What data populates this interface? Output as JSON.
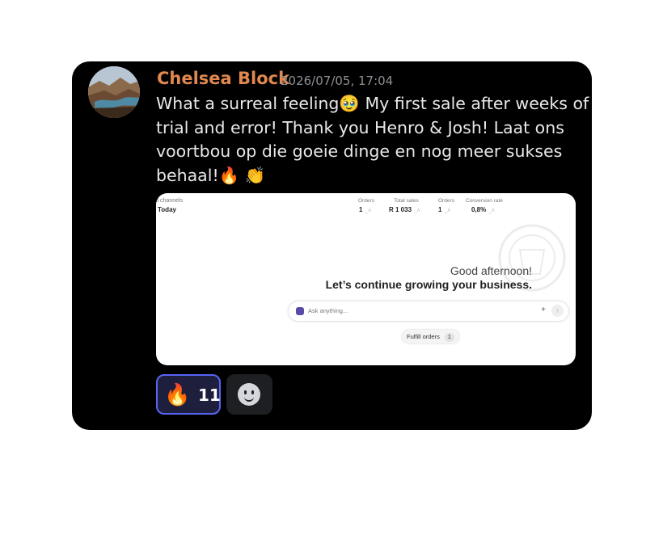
{
  "message": {
    "author": "Chelsea Block",
    "timestamp": "2026/07/05, 17:04",
    "text_lines": [
      "What a surreal feeling🥹  My first sale after weeks of",
      "trial and error! Thank you Henro & Josh! Laat ons",
      "voortbou op die goeie dinge en nog meer sukses",
      "behaal!🔥 👏"
    ]
  },
  "attachment": {
    "channels_label": "ll channels",
    "today_label": "Today",
    "metrics": [
      {
        "label": "Orders",
        "value": "1"
      },
      {
        "label": "Total sales",
        "value": "R 1 033"
      },
      {
        "label": "Orders",
        "value": "1"
      },
      {
        "label": "Conversion rate",
        "value": "0,8%"
      }
    ],
    "greeting": "Good afternoon!",
    "subgreeting": "Let’s continue growing your business.",
    "ask_placeholder": "Ask anything...",
    "plus_icon": "+",
    "send_icon": "↑",
    "fulfill_label": "Fulfill orders",
    "fulfill_count": "1"
  },
  "reactions": [
    {
      "emoji": "🔥",
      "count": "11",
      "icon": "fire-emoji"
    },
    {
      "icon": "add-reaction-smiley-icon"
    }
  ],
  "colors": {
    "author": "#e0884f",
    "card_bg": "#000000",
    "reaction_active_border": "#5865f2"
  }
}
